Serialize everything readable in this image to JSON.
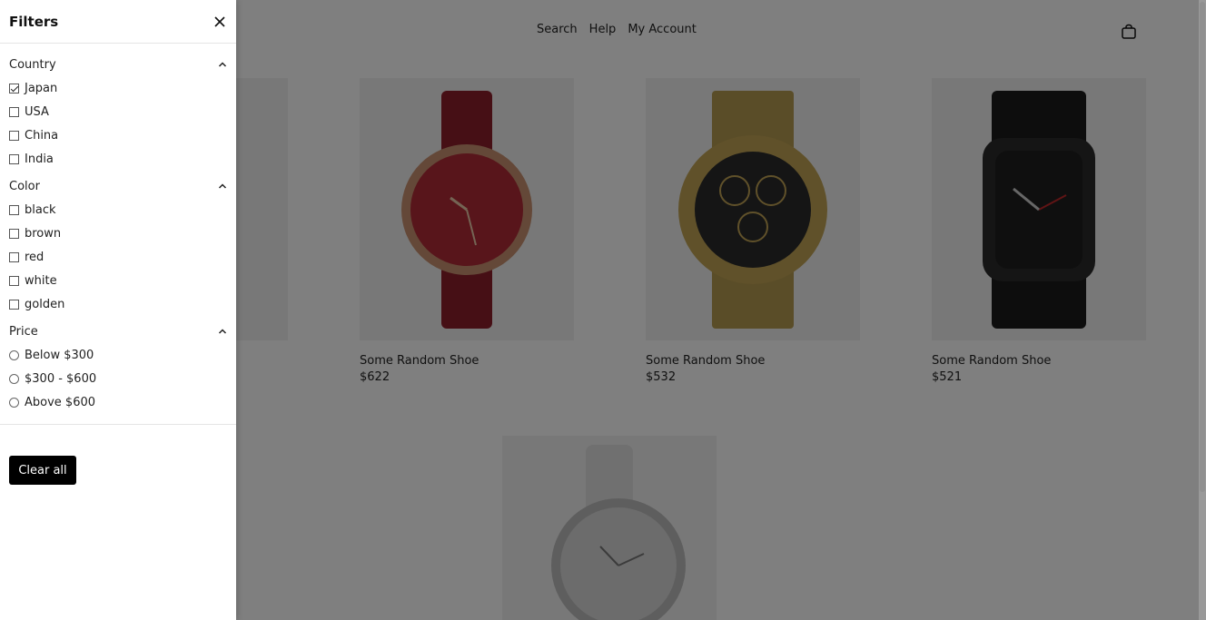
{
  "nav": {
    "search": "Search",
    "help": "Help",
    "account": "My Account"
  },
  "products": [
    {
      "name": "Some Random Shoe",
      "price": "$622",
      "dial_color": "#b02a36",
      "band_color": "#8c1f2a",
      "case_color": "#c89070"
    },
    {
      "name": "Some Random Shoe",
      "price": "$532",
      "dial_color": "#2b2b2b",
      "band_color": "#b59a50",
      "case_color": "#c0a354"
    },
    {
      "name": "Some Random Shoe",
      "price": "$521",
      "dial_color": "#1e1e1e",
      "band_color": "#1a1a1a",
      "case_color": "#2a2a2a"
    },
    {
      "name": "",
      "price": "",
      "dial_color": "#d8d8d8",
      "band_color": "#e0e0e0",
      "case_color": "#bdbdbd"
    }
  ],
  "filters": {
    "title": "Filters",
    "country": {
      "label": "Country",
      "options": [
        {
          "label": "Japan",
          "checked": true
        },
        {
          "label": "USA",
          "checked": false
        },
        {
          "label": "China",
          "checked": false
        },
        {
          "label": "India",
          "checked": false
        }
      ]
    },
    "color": {
      "label": "Color",
      "options": [
        {
          "label": "black",
          "checked": false
        },
        {
          "label": "brown",
          "checked": false
        },
        {
          "label": "red",
          "checked": false
        },
        {
          "label": "white",
          "checked": false
        },
        {
          "label": "golden",
          "checked": false
        }
      ]
    },
    "price": {
      "label": "Price",
      "options": [
        {
          "label": "Below $300"
        },
        {
          "label": "$300 - $600"
        },
        {
          "label": "Above $600"
        }
      ]
    },
    "clear_label": "Clear all"
  }
}
